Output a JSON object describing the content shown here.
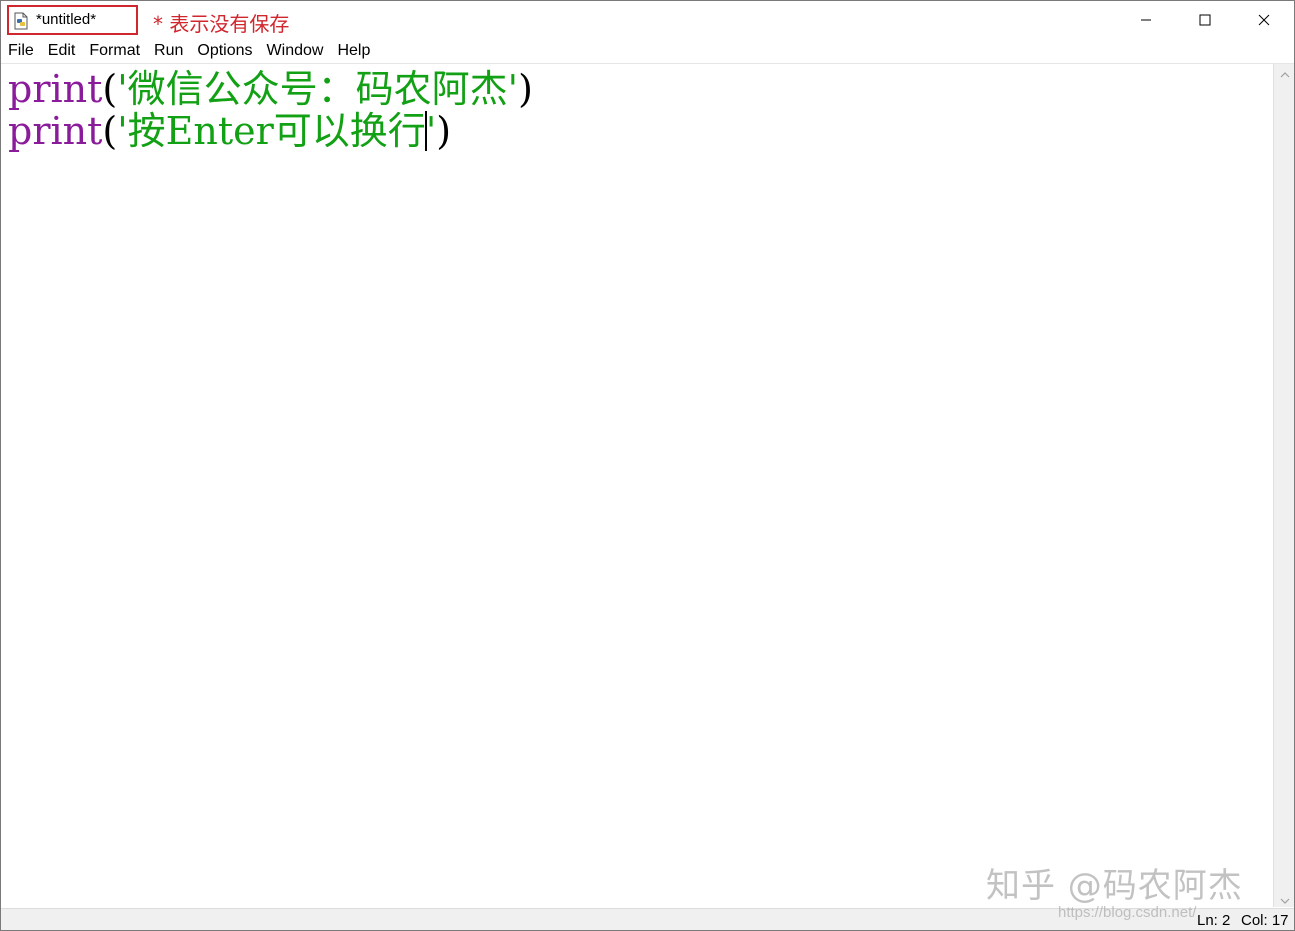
{
  "window": {
    "title": "*untitled*",
    "annotation": "* 表示没有保存"
  },
  "menu": {
    "items": [
      "File",
      "Edit",
      "Format",
      "Run",
      "Options",
      "Window",
      "Help"
    ]
  },
  "editor": {
    "lines": [
      {
        "keyword": "print",
        "open": "(",
        "string": "'微信公众号：码农阿杰'",
        "close": ")"
      },
      {
        "keyword": "print",
        "open": "(",
        "string_before_cursor": "'按Enter可以换行",
        "string_after_cursor": "'",
        "close": ")"
      }
    ]
  },
  "status": {
    "ln": "Ln: 2",
    "col": "Col: 17"
  },
  "watermark": {
    "text": "知乎 @码农阿杰",
    "url": "https://blog.csdn.net/"
  },
  "colors": {
    "keyword": "#8a1b9a",
    "string": "#12a014",
    "annotation": "#d0262e"
  },
  "icons": [
    "python-file-icon",
    "minimize-icon",
    "maximize-icon",
    "close-icon",
    "scroll-up-icon",
    "scroll-down-icon"
  ]
}
